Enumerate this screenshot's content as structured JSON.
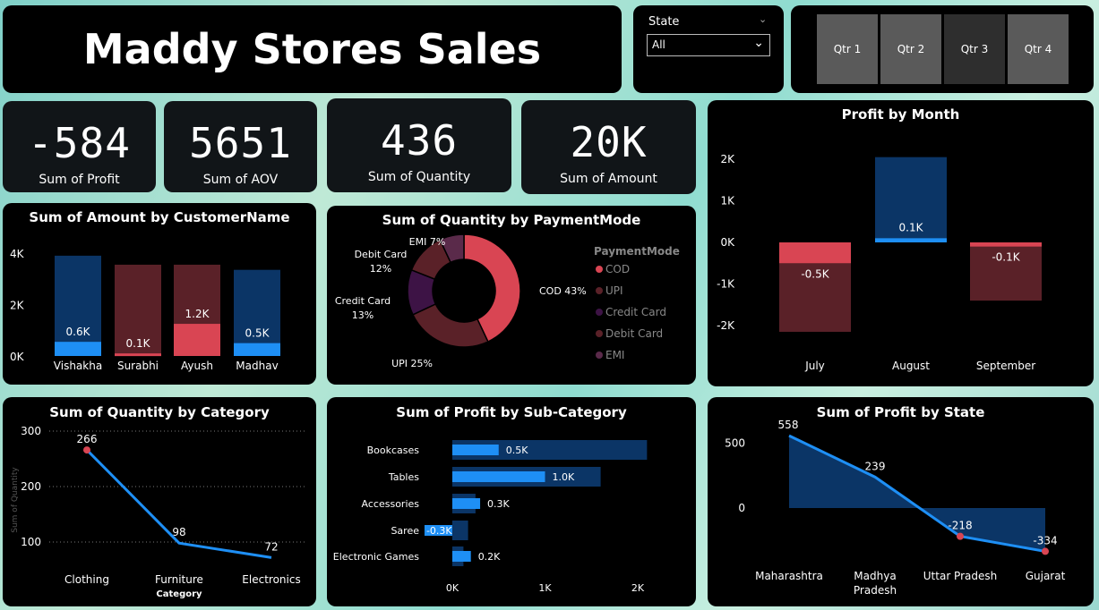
{
  "header": {
    "title": "Maddy Stores Sales"
  },
  "slicer": {
    "label": "State",
    "value": "All"
  },
  "quarters": [
    "Qtr 1",
    "Qtr 2",
    "Qtr 3",
    "Qtr 4"
  ],
  "kpis": [
    {
      "value": "-584",
      "label": "Sum of Profit"
    },
    {
      "value": "5651",
      "label": "Sum of AOV"
    },
    {
      "value": "436",
      "label": "Sum of Quantity"
    },
    {
      "value": "20K",
      "label": "Sum of Amount"
    }
  ],
  "colors": {
    "blue": "#1e8ff5",
    "navy": "#0b3566",
    "red": "#d94553",
    "maroon": "#5a2128",
    "purple": "#3d1345",
    "plum": "#5a2a4a"
  },
  "chart_data": [
    {
      "id": "profit_by_month",
      "type": "bar",
      "title": "Profit by Month",
      "categories": [
        "July",
        "August",
        "September"
      ],
      "yticks": [
        "2K",
        "1K",
        "0K",
        "-1K",
        "-2K"
      ],
      "bars": [
        {
          "top": 0,
          "bottom": -2150,
          "value": -500,
          "label": "-0.5K"
        },
        {
          "top": 2050,
          "bottom": 0,
          "value": 100,
          "label": "0.1K"
        },
        {
          "top": 0,
          "bottom": -1400,
          "value": -100,
          "label": "-0.1K"
        }
      ],
      "ylim": [
        -2400,
        2400
      ]
    },
    {
      "id": "amount_by_customer",
      "type": "bar",
      "title": "Sum of Amount by CustomerName",
      "categories": [
        "Vishakha",
        "Surabhi",
        "Ayush",
        "Madhav"
      ],
      "yticks": [
        "4K",
        "2K",
        "0K"
      ],
      "totals": [
        3900,
        3550,
        3550,
        3350
      ],
      "highlight": [
        550,
        100,
        1250,
        500
      ],
      "highlight_labels": [
        "0.6K",
        "0.1K",
        "1.2K",
        "0.5K"
      ],
      "ylim": [
        0,
        4000
      ]
    },
    {
      "id": "quantity_by_payment",
      "type": "pie",
      "title": "Sum of Quantity by PaymentMode",
      "legend_title": "PaymentMode",
      "slices": [
        {
          "name": "COD",
          "value": 43,
          "label": "COD 43%"
        },
        {
          "name": "UPI",
          "value": 25,
          "label": "UPI 25%"
        },
        {
          "name": "Credit Card",
          "value": 13,
          "label": "Credit Card 13%"
        },
        {
          "name": "Debit Card",
          "value": 12,
          "label": "Debit Card 12%"
        },
        {
          "name": "EMI",
          "value": 7,
          "label": "EMI 7%"
        }
      ]
    },
    {
      "id": "quantity_by_category",
      "type": "line",
      "title": "Sum of Quantity by Category",
      "categories": [
        "Clothing",
        "Furniture",
        "Electronics"
      ],
      "values": [
        266,
        98,
        72
      ],
      "yticks": [
        300,
        200,
        100
      ],
      "xlabel": "Category",
      "ylabel": "Sum of Quantity",
      "ylim": [
        50,
        320
      ]
    },
    {
      "id": "profit_by_subcategory",
      "type": "bar",
      "title": "Sum of Profit by Sub-Category",
      "categories": [
        "Bookcases",
        "Tables",
        "Accessories",
        "Saree",
        "Electronic Games"
      ],
      "totals": [
        2100,
        1600,
        250,
        170,
        120
      ],
      "values": [
        500,
        1000,
        300,
        -300,
        200
      ],
      "labels": [
        "0.5K",
        "1.0K",
        "0.3K",
        "-0.3K",
        "0.2K"
      ],
      "xticks": [
        "0K",
        "1K",
        "2K"
      ],
      "xlim": [
        0,
        2200
      ]
    },
    {
      "id": "profit_by_state",
      "type": "area",
      "title": "Sum of Profit by State",
      "categories": [
        "Maharashtra",
        "Madhya Pradesh",
        "Uttar Pradesh",
        "Gujarat"
      ],
      "values": [
        558,
        239,
        -218,
        -334
      ],
      "yticks": [
        500,
        0
      ],
      "ylim": [
        -420,
        620
      ]
    }
  ]
}
